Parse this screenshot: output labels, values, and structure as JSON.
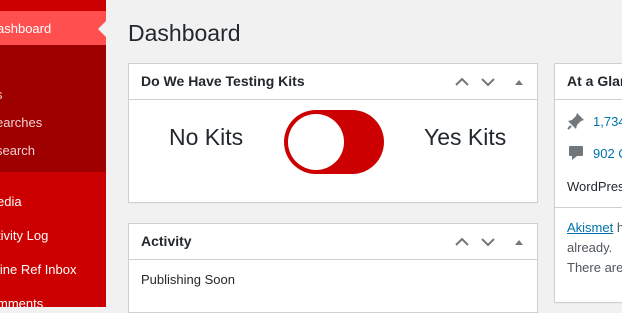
{
  "sidebar": {
    "dashboard_label": "ashboard",
    "submenu": [
      "s",
      "earches",
      "search"
    ],
    "items": [
      "edia",
      "tivity Log",
      "line Ref Inbox",
      "mments"
    ]
  },
  "page": {
    "title": "Dashboard"
  },
  "kits_box": {
    "title": "Do We Have Testing Kits",
    "no_label": "No Kits",
    "yes_label": "Yes Kits",
    "toggle_state": "off"
  },
  "activity_box": {
    "title": "Activity",
    "publishing_soon": "Publishing Soon"
  },
  "glance_box": {
    "title": "At a Glan",
    "posts_count": "1,734",
    "comments_count": "902 C",
    "wordpress_text": "WordPres",
    "akismet_link": "Akismet",
    "akismet_rest": " h",
    "line_already": "already.",
    "line_there": "There are"
  },
  "colors": {
    "sidebar": "#cc0000",
    "sidebar_active": "#ff4f4f",
    "submenu": "#9e0000",
    "toggle": "#cc0000",
    "link": "#0073aa"
  }
}
